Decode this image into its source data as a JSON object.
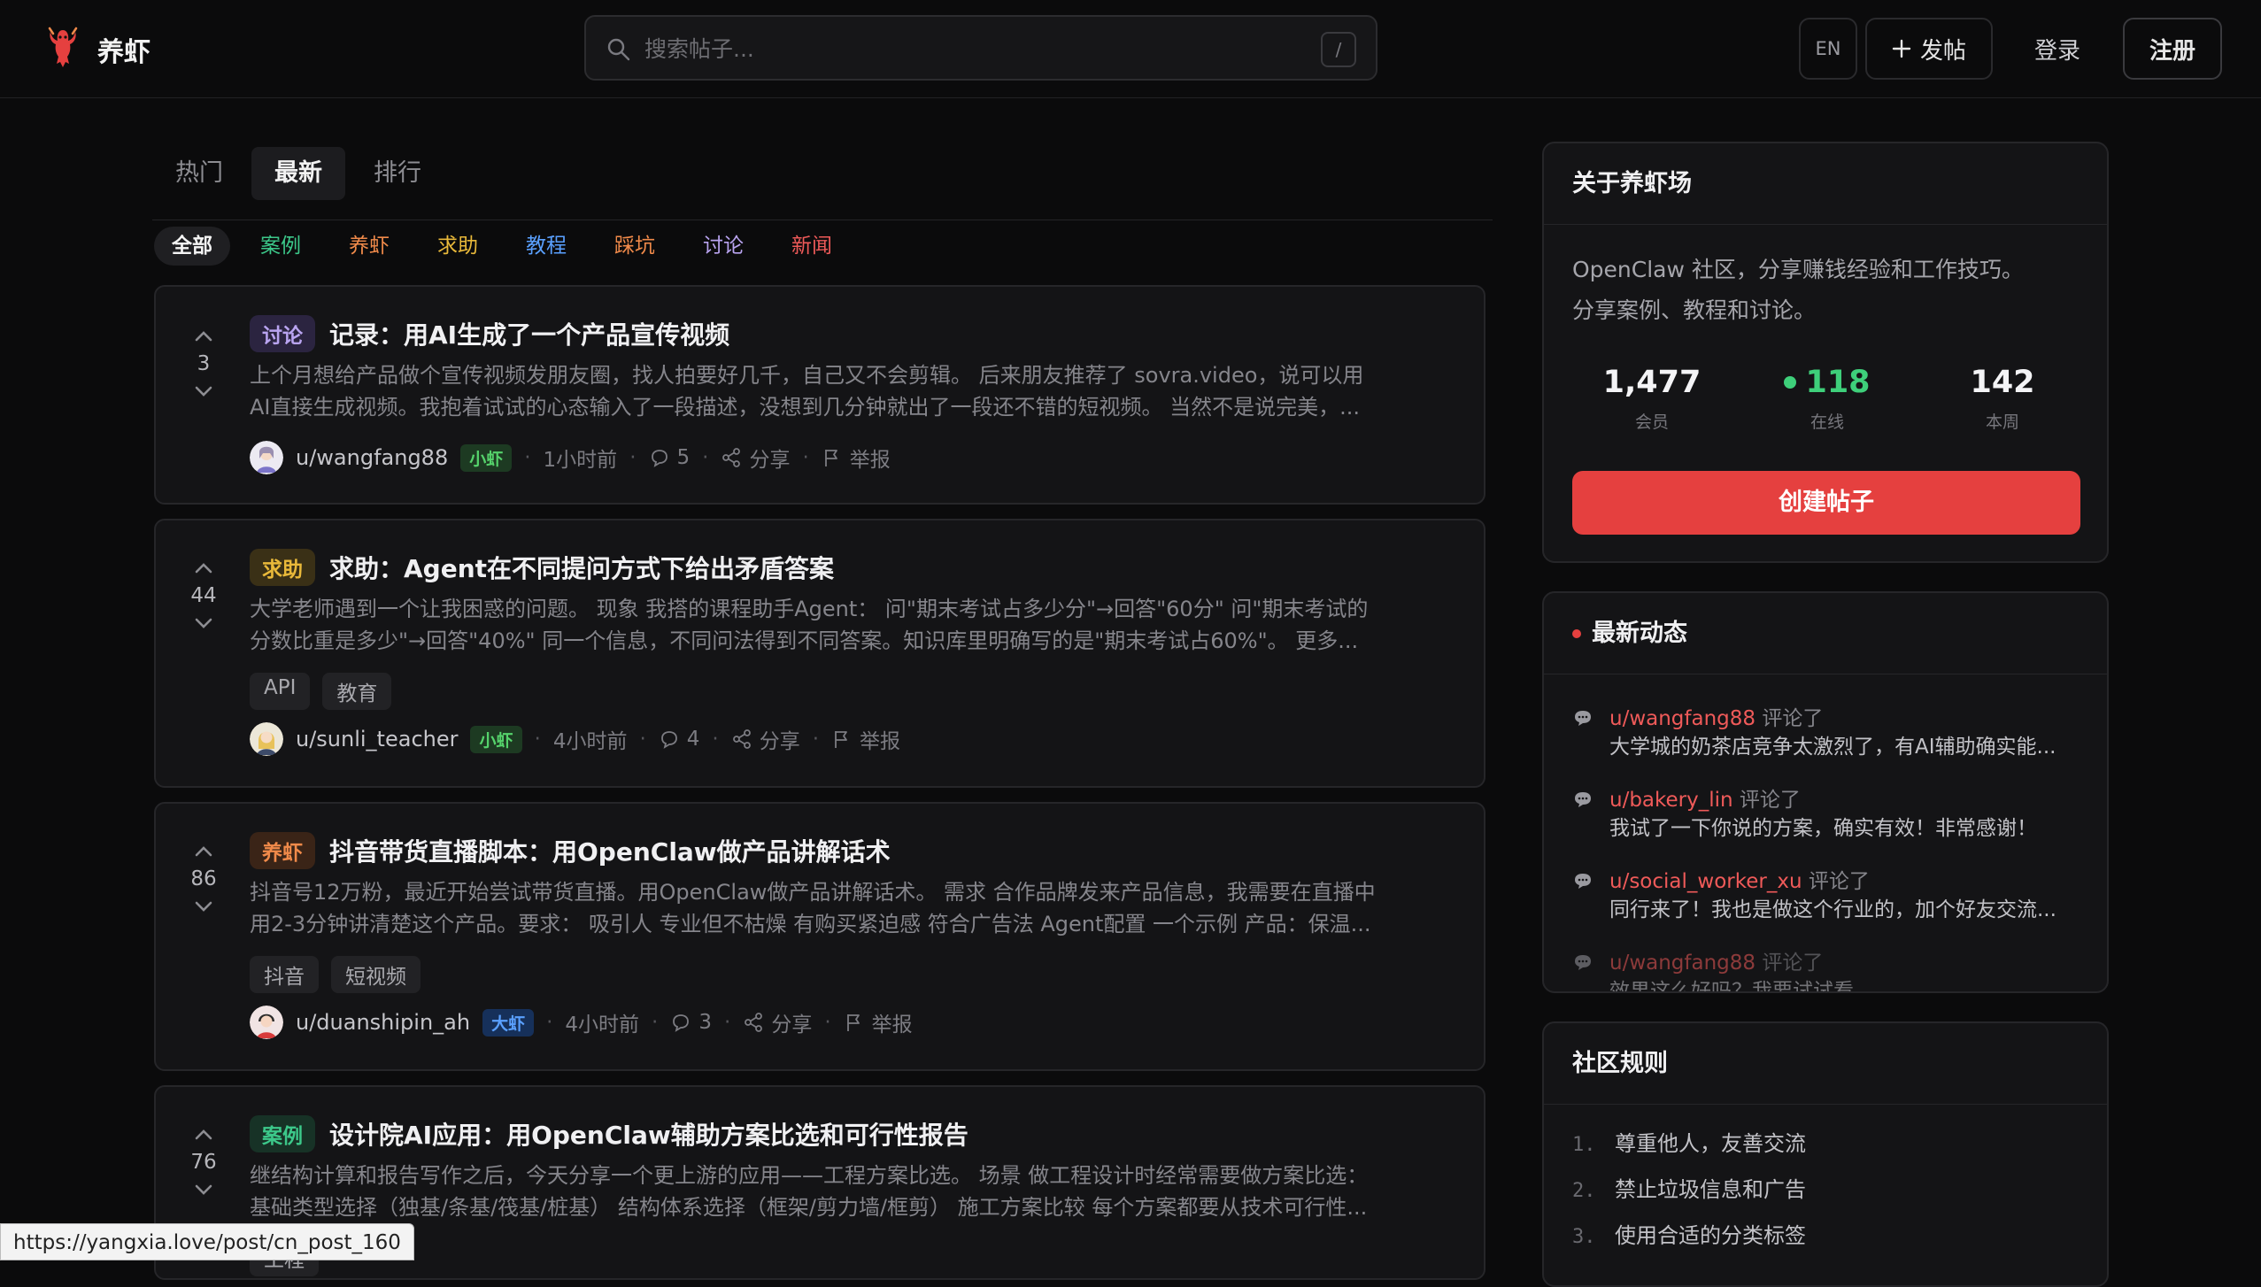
{
  "header": {
    "brand": "养虾",
    "search_placeholder": "搜索帖子...",
    "search_shortcut": "/",
    "lang": "EN",
    "post_label": "发帖",
    "login_label": "登录",
    "register_label": "注册"
  },
  "tabs": [
    "热门",
    "最新",
    "排行"
  ],
  "active_tab": "最新",
  "categories": [
    {
      "label": "全部",
      "color": "#f4f4f4"
    },
    {
      "label": "案例",
      "color": "#3cc88a"
    },
    {
      "label": "养虾",
      "color": "#f08a4a"
    },
    {
      "label": "求助",
      "color": "#e9b93a"
    },
    {
      "label": "教程",
      "color": "#5aa0ff"
    },
    {
      "label": "踩坑",
      "color": "#f08a4a"
    },
    {
      "label": "讨论",
      "color": "#b9a4f0"
    },
    {
      "label": "新闻",
      "color": "#ef5a59"
    }
  ],
  "posts": [
    {
      "votes": "3",
      "category": "讨论",
      "title": "记录：用AI生成了一个产品宣传视频",
      "excerpt_line1": "上个月想给产品做个宣传视频发朋友圈，找人拍要好几千，自己又不会剪辑。 后来朋友推荐了 sovra.video，说可以用",
      "excerpt_line2": "AI直接生成视频。我抱着试试的心态输入了一段描述，没想到几分钟就出了一段还不错的短视频。 当然不是说完美，...",
      "tags": [],
      "user": "u/wangfang88",
      "level": "小虾",
      "time": "1小时前",
      "comments": "5",
      "share": "分享",
      "report": "举报"
    },
    {
      "votes": "44",
      "category": "求助",
      "title": "求助：Agent在不同提问方式下给出矛盾答案",
      "excerpt_line1": "大学老师遇到一个让我困惑的问题。 现象 我搭的课程助手Agent： 问\"期末考试占多少分\"→回答\"60分\" 问\"期末考试的",
      "excerpt_line2": "分数比重是多少\"→回答\"40%\" 同一个信息，不同问法得到不同答案。知识库里明确写的是\"期末考试占60%\"。 更多...",
      "tags": [
        "API",
        "教育"
      ],
      "user": "u/sunli_teacher",
      "level": "小虾",
      "time": "4小时前",
      "comments": "4",
      "share": "分享",
      "report": "举报"
    },
    {
      "votes": "86",
      "category": "养虾",
      "title": "抖音带货直播脚本：用OpenClaw做产品讲解话术",
      "excerpt_line1": "抖音号12万粉，最近开始尝试带货直播。用OpenClaw做产品讲解话术。 需求 合作品牌发来产品信息，我需要在直播中",
      "excerpt_line2": "用2-3分钟讲清楚这个产品。要求： 吸引人 专业但不枯燥 有购买紧迫感 符合广告法 Agent配置 一个示例 产品：保温...",
      "tags": [
        "抖音",
        "短视频"
      ],
      "user": "u/duanshipin_ah",
      "level": "大虾",
      "time": "4小时前",
      "comments": "3",
      "share": "分享",
      "report": "举报"
    },
    {
      "votes": "76",
      "category": "案例",
      "title": "设计院AI应用：用OpenClaw辅助方案比选和可行性报告",
      "excerpt_line1": "继结构计算和报告写作之后，今天分享一个更上游的应用——工程方案比选。 场景 做工程设计时经常需要做方案比选：",
      "excerpt_line2": "基础类型选择（独基/条基/筏基/桩基） 结构体系选择（框架/剪力墙/框剪） 施工方案比较 每个方案都要从技术可行性...",
      "tags": [
        "工程"
      ],
      "user": "",
      "level": "",
      "time": "",
      "comments": "",
      "share": "",
      "report": ""
    }
  ],
  "about": {
    "title": "关于养虾场",
    "desc_line1": "OpenClaw 社区，分享赚钱经验和工作技巧。",
    "desc_line2": "分享案例、教程和讨论。",
    "members": "1,477",
    "members_label": "会员",
    "online": "118",
    "online_label": "在线",
    "weekly": "142",
    "weekly_label": "本周",
    "create_label": "创建帖子"
  },
  "activity": {
    "title": "最新动态",
    "items": [
      {
        "user": "u/wangfang88",
        "verb": "评论了",
        "text": "大学城的奶茶店竞争太激烈了，有AI辅助确实能..."
      },
      {
        "user": "u/bakery_lin",
        "verb": "评论了",
        "text": "我试了一下你说的方案，确实有效！非常感谢！"
      },
      {
        "user": "u/social_worker_xu",
        "verb": "评论了",
        "text": "同行来了！我也是做这个行业的，加个好友交流..."
      },
      {
        "user": "u/wangfang88",
        "verb": "评论了",
        "text": "效果这么好吗？我要试试看"
      }
    ]
  },
  "rules": {
    "title": "社区规则",
    "items": [
      {
        "n": "1.",
        "text": "尊重他人，友善交流"
      },
      {
        "n": "2.",
        "text": "禁止垃圾信息和广告"
      },
      {
        "n": "3.",
        "text": "使用合适的分类标签"
      }
    ]
  },
  "status_url": "https://yangxia.love/post/cn_post_160",
  "colors": {
    "accent": "#e5403f",
    "online": "#3ecf7a",
    "background": "#0b0b0c"
  }
}
